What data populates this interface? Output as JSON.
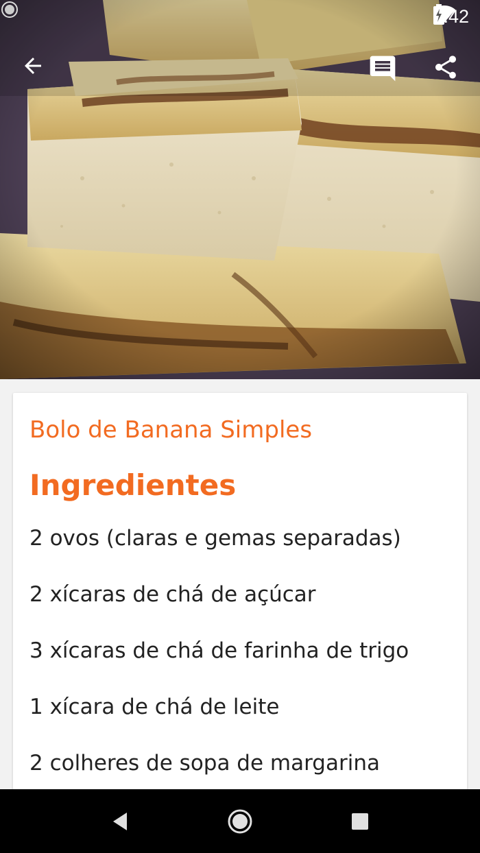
{
  "status_bar": {
    "time": "2:42",
    "icons": [
      "loading-icon",
      "wifi-icon",
      "battery-charging-icon"
    ]
  },
  "toolbar": {
    "back_icon": "arrow-back-icon",
    "comment_icon": "comment-icon",
    "share_icon": "share-icon"
  },
  "recipe": {
    "title": "Bolo de Banana Simples",
    "section_heading": "Ingredientes",
    "ingredients": [
      "2 ovos (claras e gemas separadas)",
      "2 xícaras de chá de açúcar",
      "3 xícaras de chá de farinha de trigo",
      "1 xícara de chá de leite",
      "2 colheres de sopa de margarina"
    ]
  },
  "nav_bar": {
    "icons": [
      "nav-back-icon",
      "nav-home-icon",
      "nav-recent-icon"
    ]
  },
  "colors": {
    "accent": "#f26b21",
    "text": "#222222",
    "card": "#ffffff",
    "background": "#f2f2f2"
  }
}
